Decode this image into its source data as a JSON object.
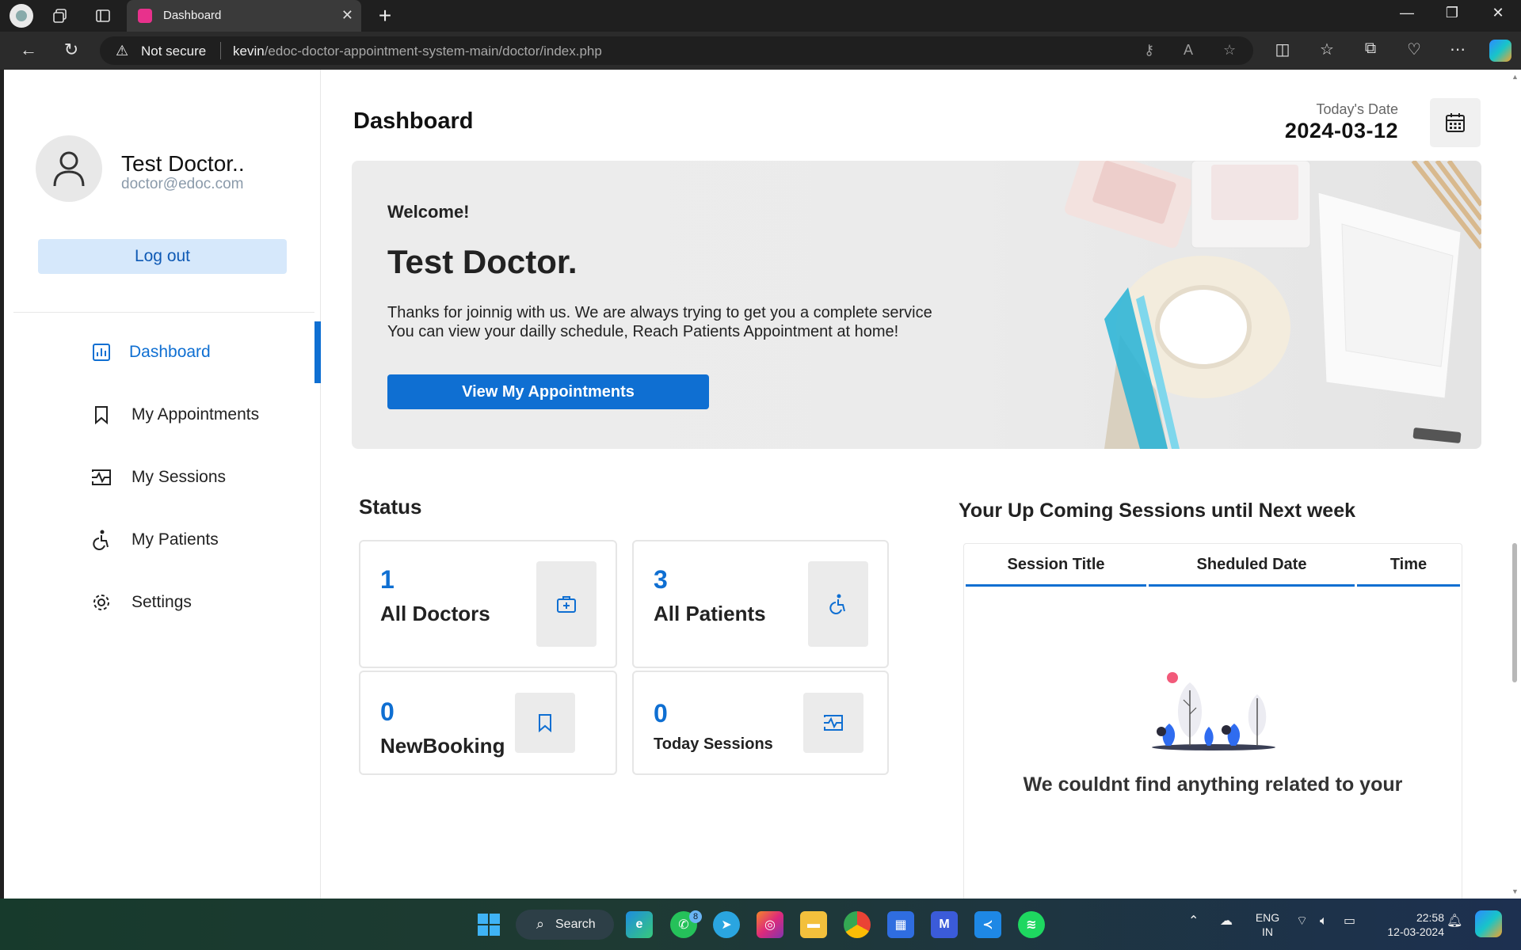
{
  "browser": {
    "tab_title": "Dashboard",
    "security_label": "Not secure",
    "url_host": "kevin",
    "url_path": "/edoc-doctor-appointment-system-main/doctor/index.php"
  },
  "profile": {
    "name": "Test Doctor..",
    "email": "doctor@edoc.com",
    "logout_label": "Log out"
  },
  "menu": [
    {
      "label": "Dashboard",
      "icon": "dashboard-icon",
      "active": true
    },
    {
      "label": "My Appointments",
      "icon": "bookmark-icon",
      "active": false
    },
    {
      "label": "My Sessions",
      "icon": "sessions-icon",
      "active": false
    },
    {
      "label": "My Patients",
      "icon": "patient-icon",
      "active": false
    },
    {
      "label": "Settings",
      "icon": "gear-icon",
      "active": false
    }
  ],
  "header": {
    "title": "Dashboard",
    "date_label": "Today's Date",
    "date_value": "2024-03-12"
  },
  "hero": {
    "welcome": "Welcome!",
    "name": "Test Doctor.",
    "message_line1": "Thanks for joinnig with us. We are always trying to get you a complete service",
    "message_line2": "You can view your dailly schedule, Reach Patients Appointment at home!",
    "cta_label": "View My Appointments"
  },
  "status": {
    "title": "Status",
    "cards": [
      {
        "value": "1",
        "label": "All Doctors",
        "icon": "medkit-icon"
      },
      {
        "value": "3",
        "label": "All Patients",
        "icon": "patient-icon"
      },
      {
        "value": "0",
        "label": "NewBooking",
        "icon": "bookmark-icon"
      },
      {
        "value": "0",
        "label": "Today Sessions",
        "icon": "sessions-icon"
      }
    ]
  },
  "upcoming": {
    "title": "Your Up Coming Sessions until Next week",
    "columns": [
      "Session Title",
      "Sheduled Date",
      "Time"
    ],
    "empty_message": "We couldnt find anything related to your"
  },
  "taskbar": {
    "search_label": "Search",
    "whatsapp_badge": "8",
    "lang_line1": "ENG",
    "lang_line2": "IN",
    "clock_time": "22:58",
    "clock_date": "12-03-2024"
  },
  "colors": {
    "accent": "#0f6fd2",
    "logout_bg": "#d6e8fb"
  }
}
